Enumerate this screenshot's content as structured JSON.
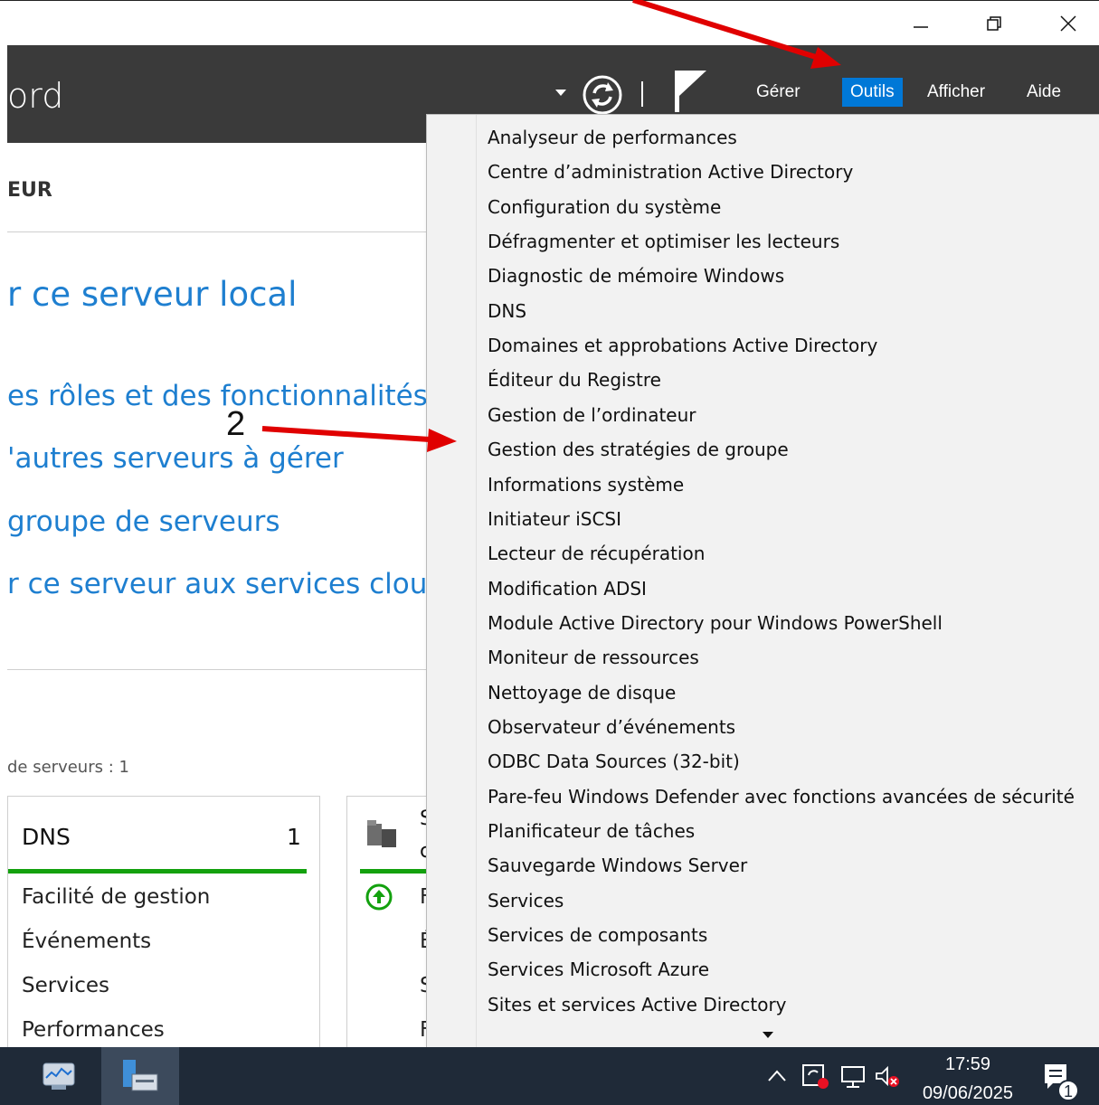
{
  "window": {
    "minimize_icon": "minimize-icon",
    "restore_icon": "restore-icon",
    "close_icon": "close-icon"
  },
  "header": {
    "title_fragment": "ord",
    "menu": {
      "gerer": "Gérer",
      "outils": "Outils",
      "afficher": "Afficher",
      "aide": "Aide"
    },
    "accent_color": "#0078d7"
  },
  "left": {
    "section_title": "EUR",
    "configure_title": "r ce serveur local",
    "links": [
      "es rôles et des fonctionnalités",
      "'autres serveurs à gérer",
      "groupe de serveurs",
      "r ce serveur aux services cloud"
    ],
    "servers_count": "de serveurs : 1",
    "tile_dns": {
      "title": "DNS",
      "count": "1",
      "rows": [
        "Facilité de gestion",
        "Événements",
        "Services",
        "Performances"
      ]
    },
    "tile2": {
      "title_fragment_1": "S",
      "title_fragment_2": "c",
      "rows": [
        "F",
        "É",
        "S",
        "F"
      ]
    },
    "status_color": "#13a10e"
  },
  "dropdown": {
    "items": [
      "Analyseur de performances",
      "Centre d’administration Active Directory",
      "Configuration du système",
      "Défragmenter et optimiser les lecteurs",
      "Diagnostic de mémoire Windows",
      "DNS",
      "Domaines et approbations Active Directory",
      "Éditeur du Registre",
      "Gestion de l’ordinateur",
      "Gestion des stratégies de groupe",
      "Informations système",
      "Initiateur iSCSI",
      "Lecteur de récupération",
      "Modification ADSI",
      "Module Active Directory pour Windows PowerShell",
      "Moniteur de ressources",
      "Nettoyage de disque",
      "Observateur d’événements",
      "ODBC Data Sources (32-bit)",
      "Pare-feu Windows Defender avec fonctions avancées de sécurité",
      "Planificateur de tâches",
      "Sauvegarde Windows Server",
      "Services",
      "Services de composants",
      "Services Microsoft Azure",
      "Sites et services Active Directory"
    ]
  },
  "annotation": {
    "step_label": "2",
    "color": "#e00000"
  },
  "taskbar": {
    "time": "17:59",
    "date": "09/06/2025",
    "notification_count": "1"
  }
}
